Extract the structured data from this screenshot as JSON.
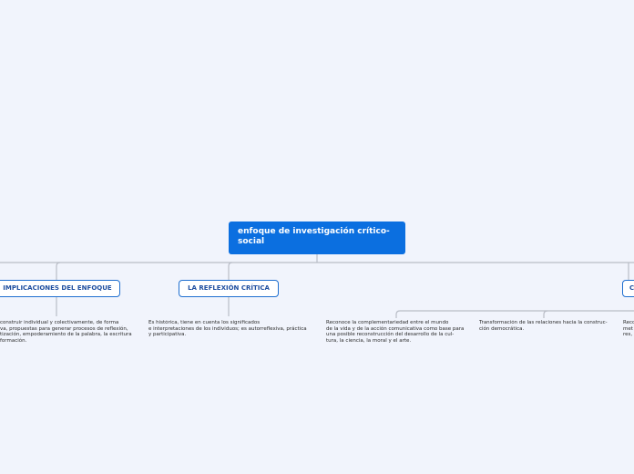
{
  "central_topic": "enfoque de investigación crítico-social",
  "branches": [
    {
      "label": "IMPLICACIONES DEL ENFOQUE",
      "note": "construir individual y colectivamente, de forma\nva, propuestas para generar procesos de reflexión,\ntización, empoderamiento de la palabra, la escritura\nformación."
    },
    {
      "label": "LA REFLEXIÓN CRÍTICA",
      "note": "Es histórica, tiene en cuenta los significados\ne interpretaciones de los individuos; es autorreflexiva, práctica\ny participativa."
    },
    {
      "label": "C",
      "subnotes": [
        "Reconoce la complementariedad entre el mundo\nde la vida y de la acción comunicativa como base para\nuna posible reconstrucción del desarrollo de la cul-\ntura, la ciencia, la moral y el arte.",
        "Transformación de las relaciones hacia la construc-\nción democrática.",
        "Reco\nmet\nres,"
      ]
    }
  ],
  "colors": {
    "background": "#f1f4fc",
    "central": "#0b6fe0",
    "topic_border": "#1f6fd0",
    "topic_text": "#1f4fa0",
    "connector": "#b9bdc6"
  }
}
